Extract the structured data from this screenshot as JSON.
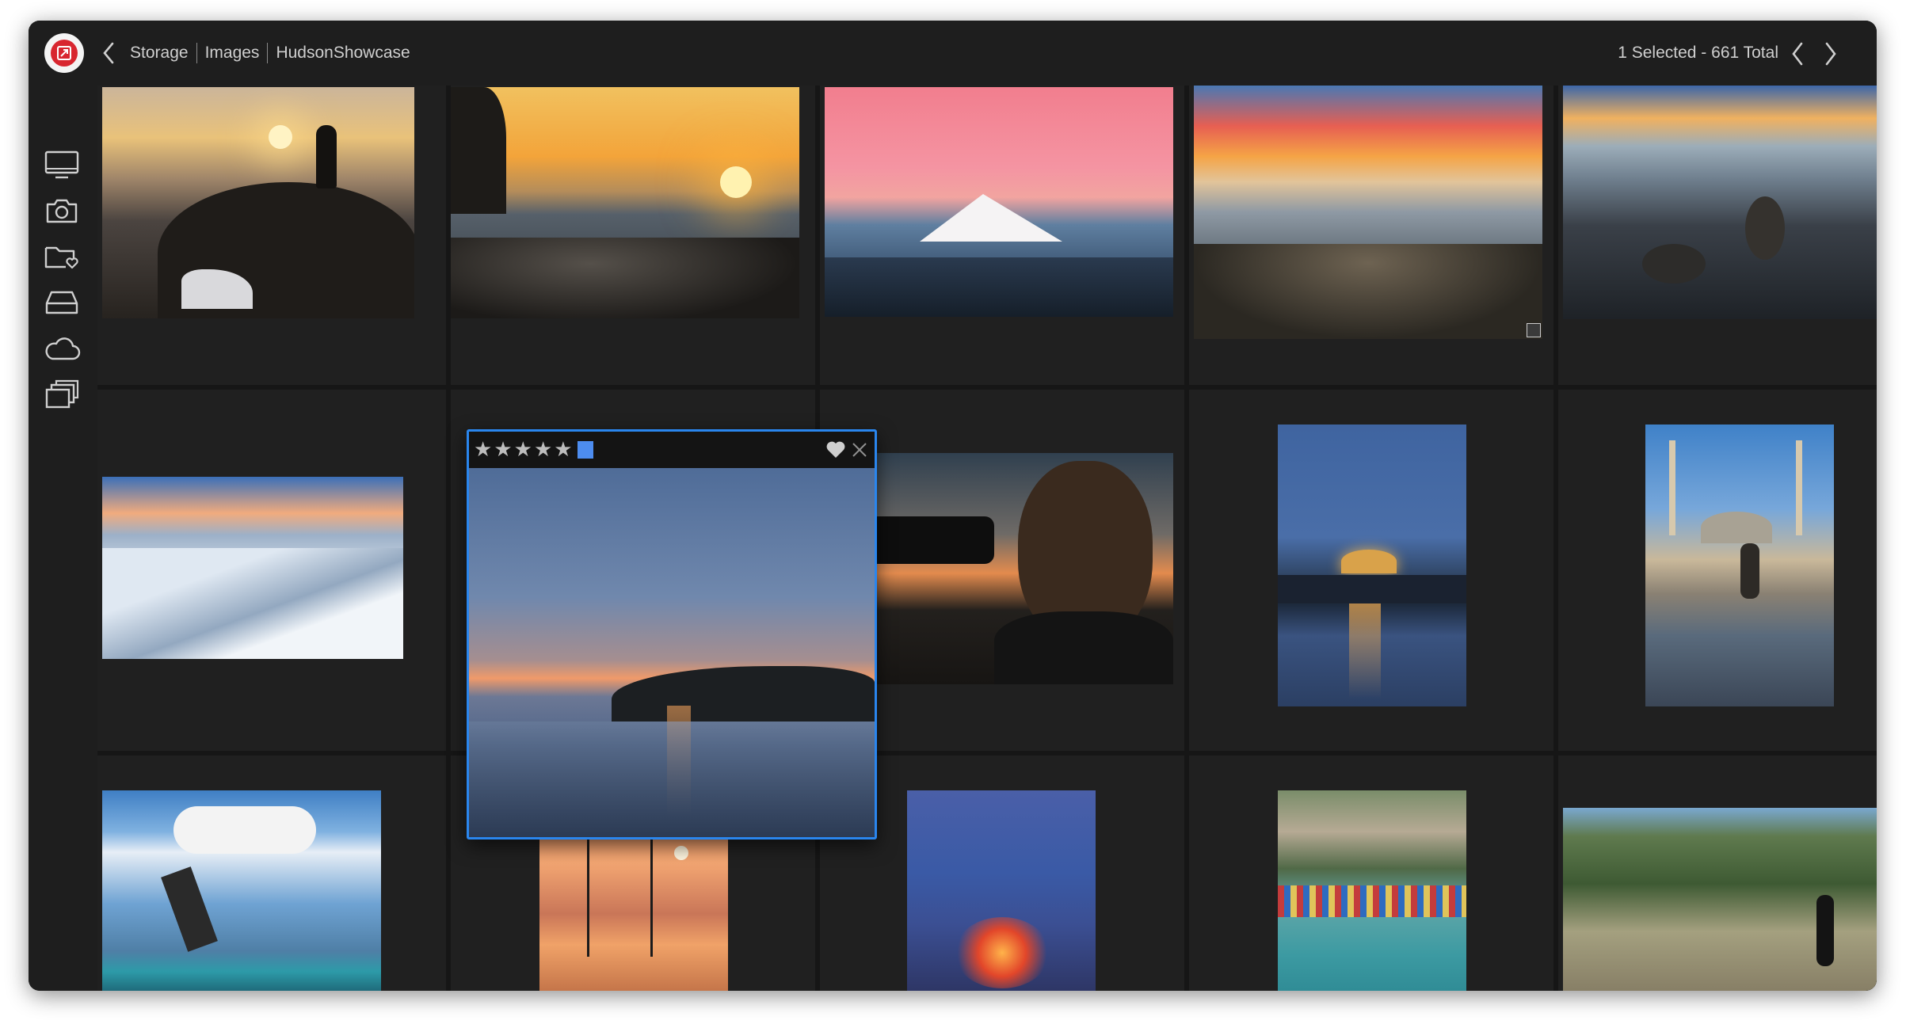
{
  "breadcrumb": {
    "items": [
      "Storage",
      "Images",
      "HudsonShowcase"
    ]
  },
  "status": {
    "text": "1 Selected - 661 Total"
  },
  "sidebar": {
    "icons": [
      "monitor-icon",
      "camera-icon",
      "folder-heart-icon",
      "drive-icon",
      "cloud-icon",
      "albums-icon"
    ]
  },
  "selected_photo": {
    "rating_stars": [
      "★",
      "★",
      "★",
      "★",
      "★"
    ],
    "rating": 5,
    "color_label": "#4d8df0",
    "accent": "#2a86ee"
  },
  "thumbnails": [
    "photographer-sunrise-cliff",
    "coastal-sunset-rocks",
    "mount-hood-pink-sky",
    "rocky-shore-sunset",
    "tide-pool-rocks",
    "snowy-mountain-ridge",
    "photographer-with-camera",
    "istanbul-mosque-night",
    "blue-mosque-courtyard",
    "kitesurfer",
    "sailboats-sunset",
    "volcano-eruption",
    "amalfi-beach",
    "cliff-wall-woman",
    "seaside-village-dusk"
  ]
}
